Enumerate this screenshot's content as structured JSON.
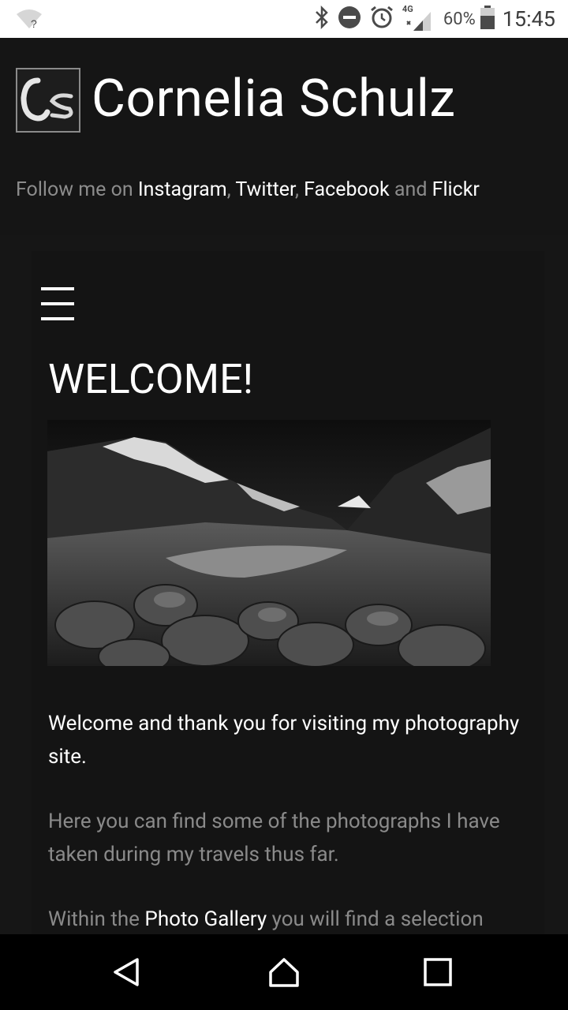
{
  "status_bar": {
    "time": "15:45",
    "battery": "60%",
    "network": "4G",
    "icons": [
      "wifi-unknown-icon",
      "bluetooth-icon",
      "do-not-disturb-icon",
      "alarm-icon",
      "signal-icon",
      "battery-icon"
    ]
  },
  "header": {
    "logo_text": "Cs",
    "site_title": "Cornelia Schulz",
    "follow_prefix": "Follow me on ",
    "links": [
      "Instagram",
      "Twitter",
      "Facebook",
      "Flickr"
    ],
    "sep1": ", ",
    "sep2": ", ",
    "and": " and "
  },
  "main": {
    "menu_icon": "hamburger-menu-icon",
    "heading": "WELCOME!",
    "intro": "Welcome and thank you for visiting my photography site.",
    "para2": "Here you can find some of the photographs I have taken during my travels thus far.",
    "para3_prefix": "Within the ",
    "para3_link": "Photo Gallery",
    "para3_suffix": " you will find a selection"
  },
  "nav_bar": {
    "icons": [
      "back-icon",
      "home-icon",
      "recents-icon"
    ]
  },
  "colors": {
    "background": "#141414",
    "muted_text": "#8a8a8a",
    "link_text": "#ffffff"
  }
}
